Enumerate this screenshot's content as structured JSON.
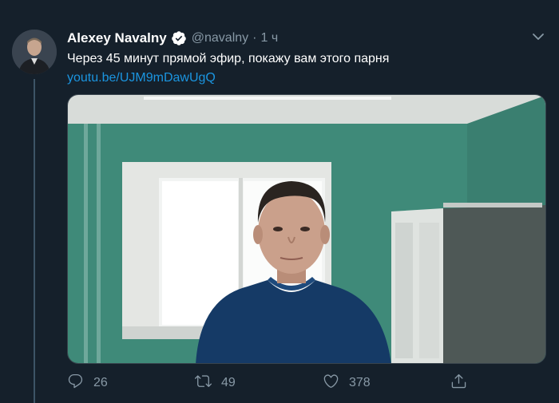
{
  "tweet": {
    "author_name": "Alexey Navalny",
    "handle": "@navalny",
    "separator": "·",
    "time": "1 ч",
    "text": "Через 45 минут прямой эфир, покажу вам этого парня",
    "link": "youtu.be/UJM9mDawUgQ"
  },
  "actions": {
    "reply": {
      "icon": "reply-icon",
      "count": "26"
    },
    "retweet": {
      "icon": "retweet-icon",
      "count": "49"
    },
    "like": {
      "icon": "heart-icon",
      "count": "378"
    },
    "share": {
      "icon": "share-icon"
    }
  },
  "colors": {
    "background": "#15202b",
    "secondary_text": "#8899a6",
    "link": "#1b95e0",
    "verified": "#ffffff",
    "thread_line": "#3d5466"
  }
}
